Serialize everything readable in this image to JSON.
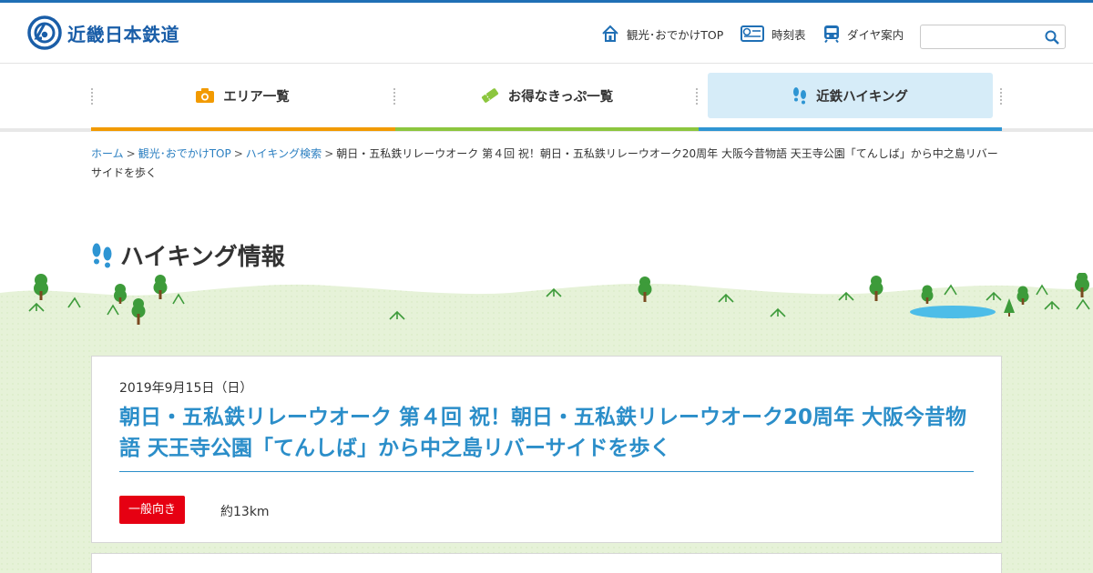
{
  "header": {
    "logo_text": "近畿日本鉄道",
    "nav": [
      {
        "label": "観光･おでかけTOP",
        "icon": "house-icon"
      },
      {
        "label": "時刻表",
        "icon": "timetable-icon"
      },
      {
        "label": "ダイヤ案内",
        "icon": "train-icon"
      }
    ],
    "search": {
      "placeholder": "",
      "value": ""
    }
  },
  "mainnav": {
    "tabs": [
      {
        "label": "エリア一覧",
        "icon": "camera-icon",
        "color": "#f29a00"
      },
      {
        "label": "お得なきっぷ一覧",
        "icon": "ticket-icon",
        "color": "#8cc63e"
      },
      {
        "label": "近鉄ハイキング",
        "icon": "footprints-icon",
        "color": "#2e95d3",
        "active": true
      }
    ]
  },
  "breadcrumb": {
    "items": [
      {
        "label": "ホーム",
        "link": true
      },
      {
        "label": "観光･おでかけTOP",
        "link": true
      },
      {
        "label": "ハイキング検索",
        "link": true
      }
    ],
    "current": "朝日・五私鉄リレーウオーク 第４回 祝！朝日・五私鉄リレーウオーク20周年 大阪今昔物語 天王寺公園「てんしば」から中之島リバーサイドを歩く"
  },
  "page": {
    "title": "ハイキング情報"
  },
  "event": {
    "date": "2019年9月15日（日）",
    "title": "朝日・五私鉄リレーウオーク 第４回 祝！朝日・五私鉄リレーウオーク20周年 大阪今昔物語 天王寺公園「てんしば」から中之島リバーサイドを歩く",
    "level": "一般向き",
    "distance": "約13km"
  },
  "colors": {
    "brand": "#1a5ea8",
    "link": "#2b7fc1",
    "title": "#2b8ec9",
    "badge": "#e60012",
    "grass": "#e6f2d8"
  }
}
